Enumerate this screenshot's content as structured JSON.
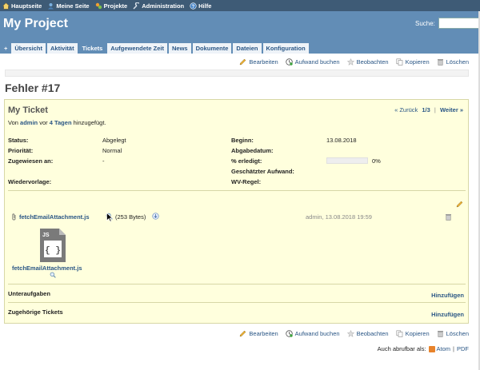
{
  "top_menu": [
    {
      "label": "Hauptseite",
      "icon": "home-icon"
    },
    {
      "label": "Meine Seite",
      "icon": "user-icon"
    },
    {
      "label": "Projekte",
      "icon": "projects-icon"
    },
    {
      "label": "Administration",
      "icon": "wrench-icon"
    },
    {
      "label": "Hilfe",
      "icon": "help-icon"
    }
  ],
  "header": {
    "title": "My Project",
    "search_label": "Suche:",
    "search_value": ""
  },
  "tabs": [
    {
      "label": "+"
    },
    {
      "label": "Übersicht"
    },
    {
      "label": "Aktivität"
    },
    {
      "label": "Tickets",
      "selected": true
    },
    {
      "label": "Aufgewendete Zeit"
    },
    {
      "label": "News"
    },
    {
      "label": "Dokumente"
    },
    {
      "label": "Dateien"
    },
    {
      "label": "Konfiguration"
    }
  ],
  "contextual": {
    "edit": "Bearbeiten",
    "log_time": "Aufwand buchen",
    "watch": "Beobachten",
    "copy": "Kopieren",
    "delete": "Löschen"
  },
  "issue": {
    "heading": "Fehler #17",
    "subject": "My Ticket",
    "nav": {
      "prev": "« Zurück",
      "count": "1/3",
      "sep": "|",
      "next": "Weiter »"
    },
    "author": {
      "prefix": "Von",
      "name": "admin",
      "mid": "vor",
      "age": "4 Tagen",
      "suffix": "hinzugefügt."
    },
    "attributes": {
      "status_label": "Status:",
      "status_value": "Abgelegt",
      "priority_label": "Priorität:",
      "priority_value": "Normal",
      "assigned_label": "Zugewiesen an:",
      "assigned_value": "-",
      "recurrence_label": "Wiedervorlage:",
      "start_label": "Beginn:",
      "start_value": "13.08.2018",
      "due_label": "Abgabedatum:",
      "done_label": "% erledigt:",
      "done_value": "0%",
      "done_fraction": 0,
      "estimate_label": "Geschätzter Aufwand:",
      "wv_rule_label": "WV-Regel:"
    },
    "attachment": {
      "filename": "fetchEmailAttachment.js",
      "size": "(253 Bytes)",
      "meta": "admin, 13.08.2018 19:59",
      "thumb_label": "JS",
      "thumb_caption": "fetchEmailAttachment.js"
    },
    "subtasks": {
      "title": "Unteraufgaben",
      "add": "Hinzufügen"
    },
    "relations": {
      "title": "Zugehörige Tickets",
      "add": "Hinzufügen"
    }
  },
  "other_formats": {
    "label": "Auch abrufbar als:",
    "atom": "Atom",
    "sep": "|",
    "pdf": "PDF"
  },
  "colors": {
    "top_menu": "#3e5b76",
    "header": "#628db6",
    "issue_bg": "#ffffdd",
    "link": "#2a5685"
  }
}
